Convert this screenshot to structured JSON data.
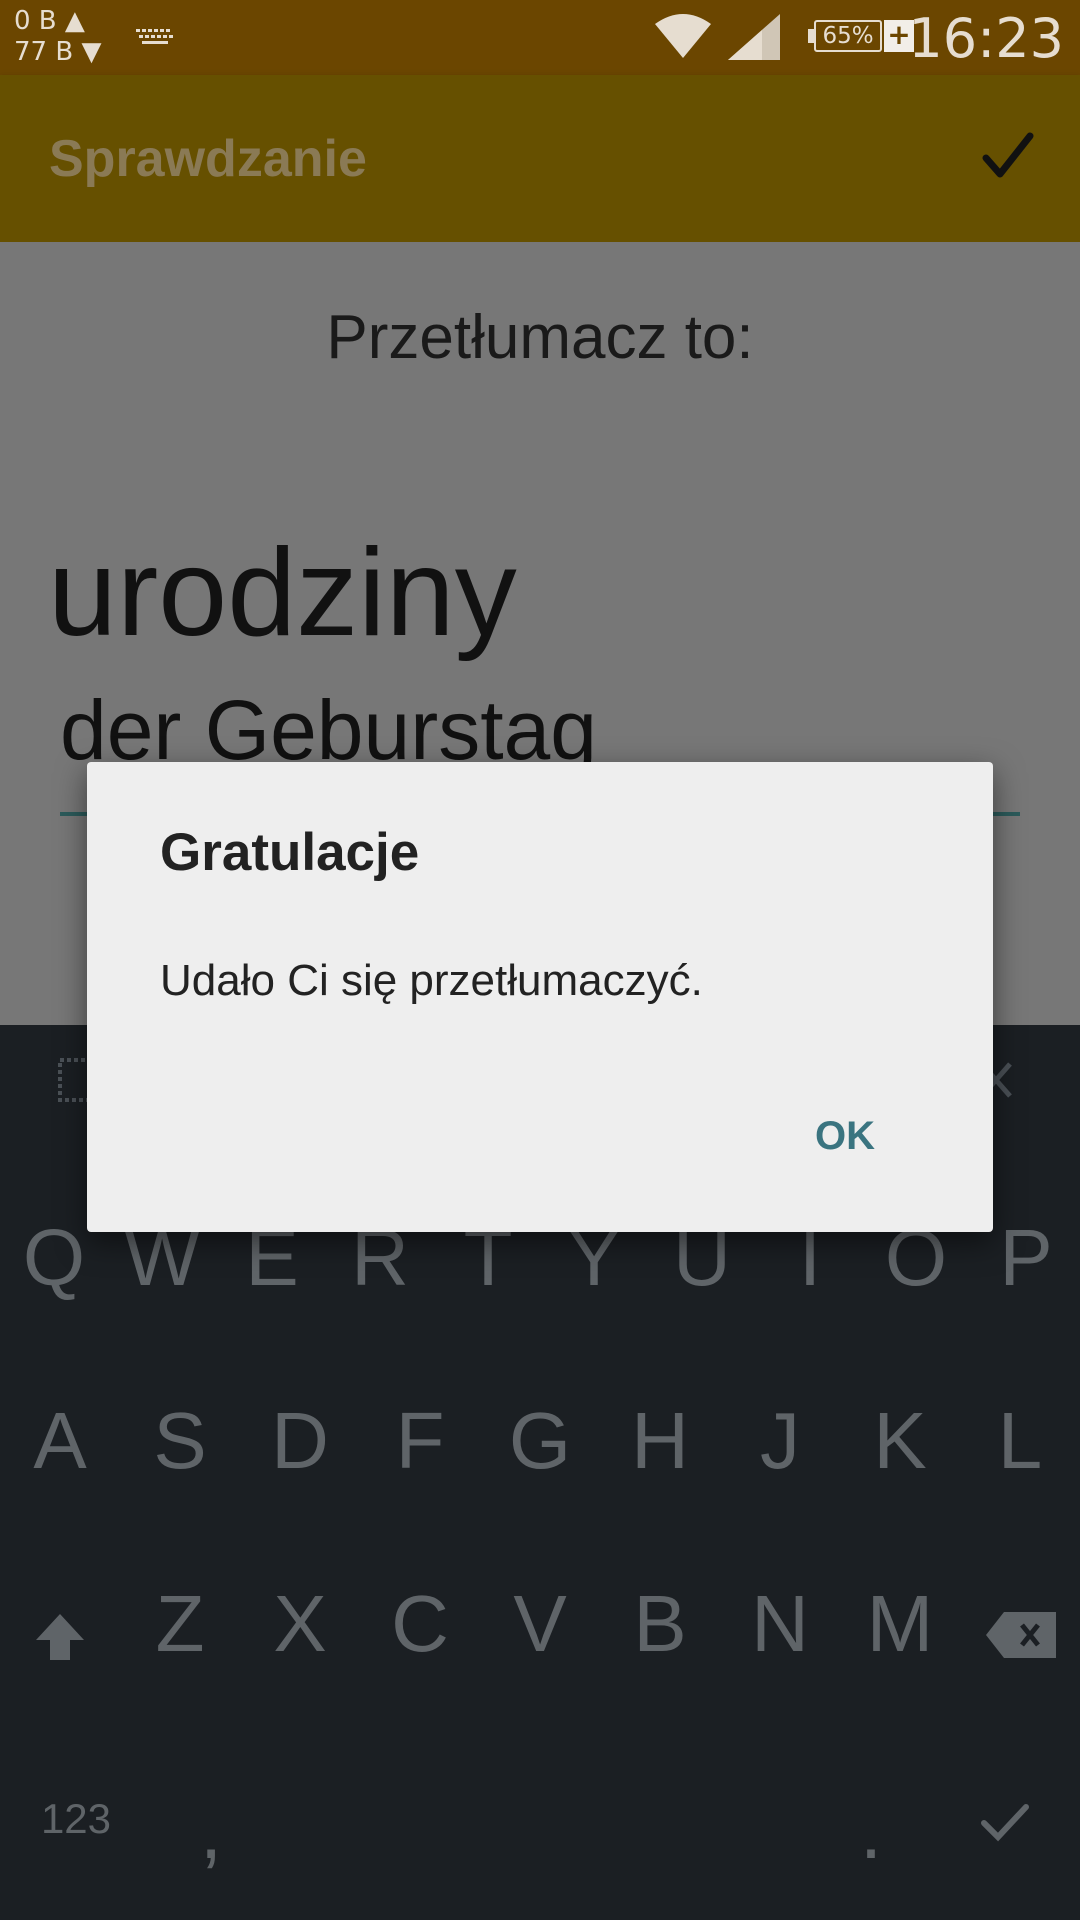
{
  "status_bar": {
    "net_up": "0 B ▲",
    "net_down": "77 B ▼",
    "battery": "65%",
    "battery_charging": "+",
    "time": "16:23"
  },
  "app_bar": {
    "title": "Sprawdzanie",
    "confirm_icon": "checkmark-icon"
  },
  "content": {
    "prompt": "Przetłumacz to:",
    "word": "urodziny",
    "answer": "der Geburstag"
  },
  "dialog": {
    "title": "Gratulacje",
    "message": "Udało Ci się przetłumaczyć.",
    "ok_label": "OK"
  },
  "keyboard": {
    "row1": [
      "Q",
      "W",
      "E",
      "R",
      "T",
      "Y",
      "U",
      "I",
      "O",
      "P"
    ],
    "row2": [
      "A",
      "S",
      "D",
      "F",
      "G",
      "H",
      "J",
      "K",
      "L"
    ],
    "row3": [
      "Z",
      "X",
      "C",
      "V",
      "B",
      "N",
      "M"
    ],
    "numbers_label": "123",
    "comma_label": ",",
    "period_label": "."
  },
  "colors": {
    "status_bar": "#6b4600",
    "app_bar": "#665000",
    "keyboard": "#1b1f23",
    "dialog_accent": "#3a7480"
  }
}
